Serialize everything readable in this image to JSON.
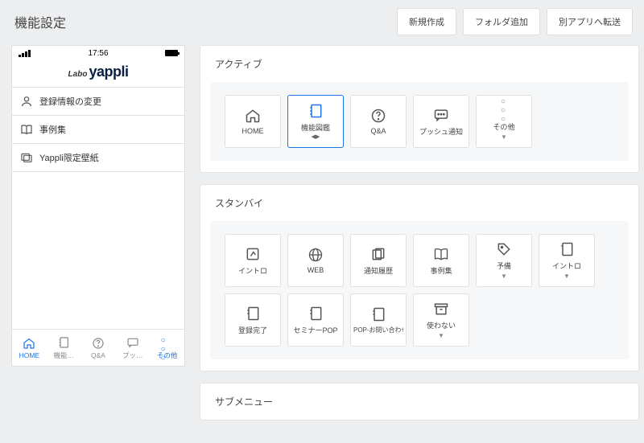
{
  "header": {
    "title": "機能設定",
    "buttons": {
      "new": "新規作成",
      "folder": "フォルダ追加",
      "transfer": "別アプリへ転送"
    }
  },
  "phone": {
    "time": "17:56",
    "brand_prefix": "Labo",
    "brand_name": "yappli",
    "menu": [
      {
        "label": "登録情報の変更"
      },
      {
        "label": "事例集"
      },
      {
        "label": "Yappli限定壁紙"
      }
    ],
    "tabs": [
      {
        "label": "HOME"
      },
      {
        "label": "機能…"
      },
      {
        "label": "Q&A"
      },
      {
        "label": "プッ…"
      },
      {
        "label": "その他"
      }
    ]
  },
  "sections": {
    "active": {
      "title": "アクティブ",
      "cards": [
        {
          "label": "HOME"
        },
        {
          "label": "機能図鑑",
          "sub": "◀▶"
        },
        {
          "label": "Q&A"
        },
        {
          "label": "プッシュ通知"
        },
        {
          "label": "その他"
        }
      ]
    },
    "standby": {
      "title": "スタンバイ",
      "cards": [
        {
          "label": "イントロ"
        },
        {
          "label": "WEB"
        },
        {
          "label": "通知履歴"
        },
        {
          "label": "事例集"
        },
        {
          "label": "予備"
        },
        {
          "label": "イントロ"
        },
        {
          "label": "登録完了"
        },
        {
          "label": "セミナーPOP"
        },
        {
          "label": "POP-お問い合わせ"
        },
        {
          "label": "使わない"
        }
      ]
    },
    "submenu": {
      "title": "サブメニュー"
    }
  }
}
